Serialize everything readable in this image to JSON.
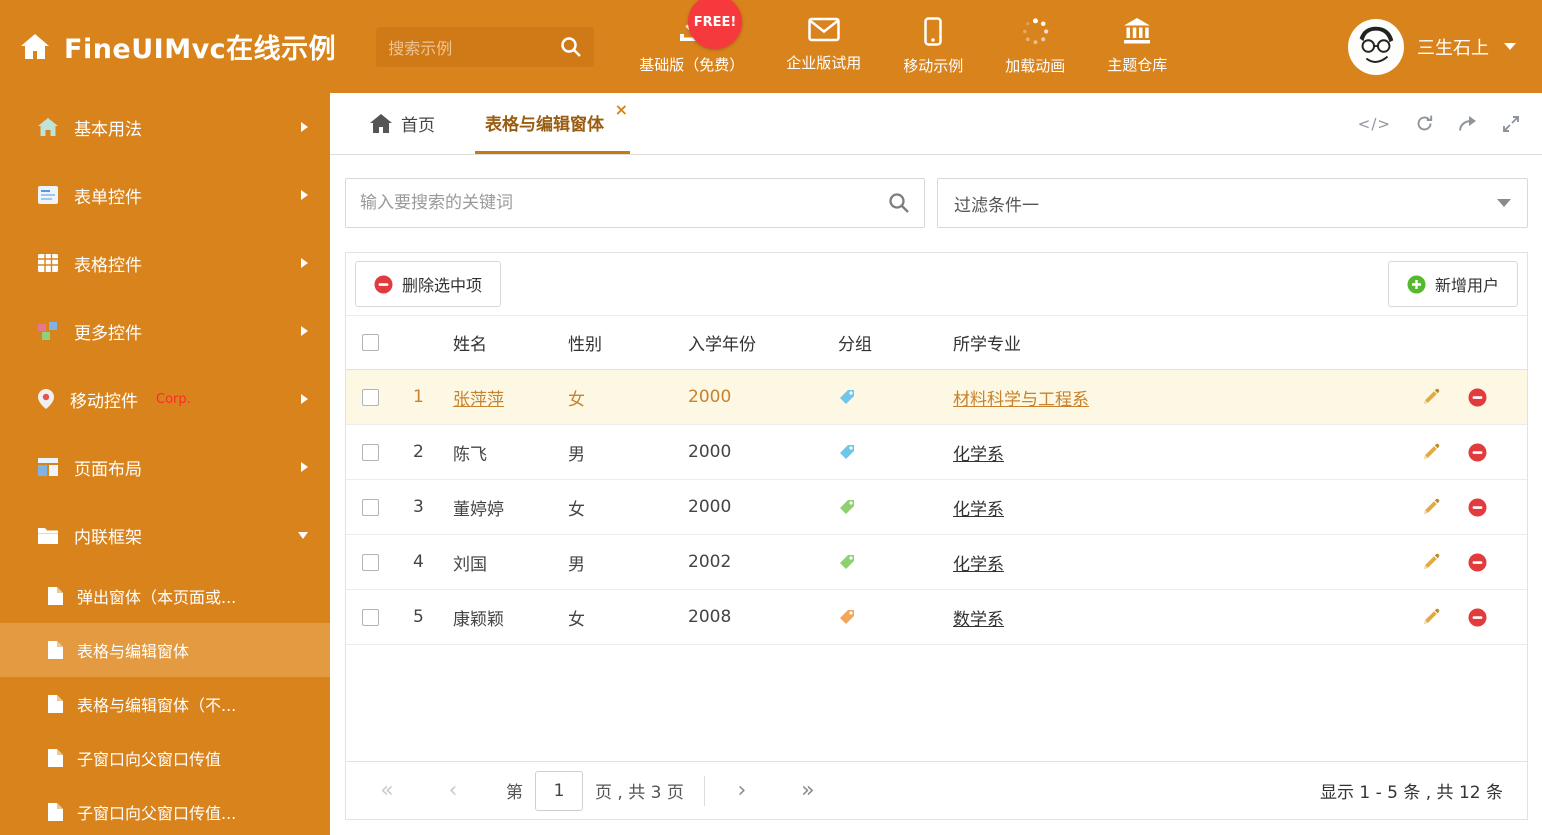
{
  "header": {
    "title": "FineUIMvc在线示例",
    "search_placeholder": "搜索示例",
    "free_badge": "FREE!",
    "nav": [
      {
        "label": "基础版（免费）",
        "icon": "download-icon"
      },
      {
        "label": "企业版试用",
        "icon": "envelope-icon"
      },
      {
        "label": "移动示例",
        "icon": "mobile-icon"
      },
      {
        "label": "加载动画",
        "icon": "spinner-icon"
      },
      {
        "label": "主题仓库",
        "icon": "bank-icon"
      }
    ],
    "username": "三生石上"
  },
  "sidebar": {
    "items": [
      {
        "label": "基本用法",
        "icon": "home-icon"
      },
      {
        "label": "表单控件",
        "icon": "form-icon"
      },
      {
        "label": "表格控件",
        "icon": "table-icon"
      },
      {
        "label": "更多控件",
        "icon": "blocks-icon"
      },
      {
        "label": "移动控件",
        "badge": "Corp.",
        "icon": "pin-icon"
      },
      {
        "label": "页面布局",
        "icon": "layout-icon"
      },
      {
        "label": "内联框架",
        "icon": "frame-icon"
      }
    ],
    "subitems": [
      {
        "label": "弹出窗体（本页面或..."
      },
      {
        "label": "表格与编辑窗体",
        "active": true
      },
      {
        "label": "表格与编辑窗体（不..."
      },
      {
        "label": "子窗口向父窗口传值"
      },
      {
        "label": "子窗口向父窗口传值..."
      }
    ]
  },
  "tabs": {
    "home": "首页",
    "active": "表格与编辑窗体"
  },
  "tab_tools": {
    "code": "</>"
  },
  "filter": {
    "search_placeholder": "输入要搜索的关键词",
    "dropdown_value": "过滤条件一"
  },
  "toolbar": {
    "delete_label": "删除选中项",
    "add_label": "新增用户"
  },
  "table": {
    "headers": {
      "name": "姓名",
      "gender": "性别",
      "year": "入学年份",
      "group": "分组",
      "major": "所学专业"
    },
    "rows": [
      {
        "num": "1",
        "name": "张萍萍",
        "gender": "女",
        "year": "2000",
        "tag_color": "#6fc6e8",
        "major": "材料科学与工程系",
        "selected": true
      },
      {
        "num": "2",
        "name": "陈飞",
        "gender": "男",
        "year": "2000",
        "tag_color": "#6fc6e8",
        "major": "化学系"
      },
      {
        "num": "3",
        "name": "董婷婷",
        "gender": "女",
        "year": "2000",
        "tag_color": "#8ed06f",
        "major": "化学系"
      },
      {
        "num": "4",
        "name": "刘国",
        "gender": "男",
        "year": "2002",
        "tag_color": "#8ed06f",
        "major": "化学系"
      },
      {
        "num": "5",
        "name": "康颖颖",
        "gender": "女",
        "year": "2008",
        "tag_color": "#f3a55a",
        "major": "数学系"
      }
    ]
  },
  "pagination": {
    "label_page": "第",
    "current": "1",
    "label_total": "页 , 共 3 页",
    "summary": "显示 1 - 5 条 , 共 12 条"
  },
  "colors": {
    "accent": "#d9831d",
    "sidebar_selected_bg": "#e39a41",
    "selected_row_bg": "#fcf8e3",
    "selected_row_text": "#c9822d",
    "free_badge_bg": "#f5393d"
  }
}
